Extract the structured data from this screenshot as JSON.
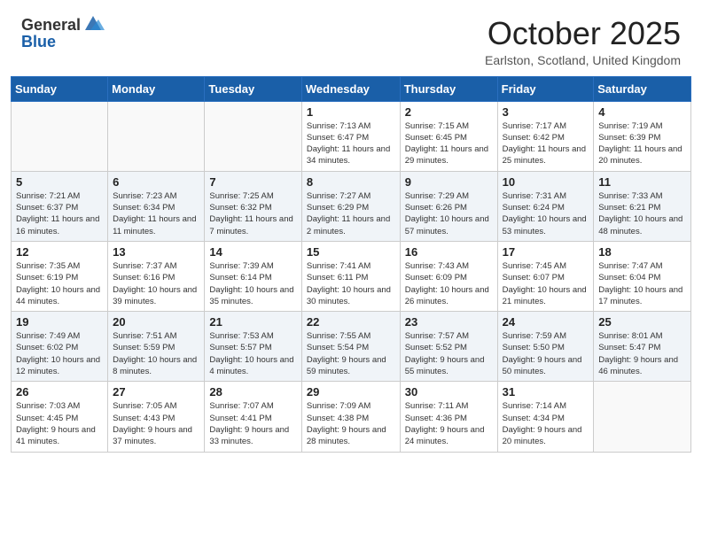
{
  "header": {
    "logo_general": "General",
    "logo_blue": "Blue",
    "month": "October 2025",
    "location": "Earlston, Scotland, United Kingdom"
  },
  "weekdays": [
    "Sunday",
    "Monday",
    "Tuesday",
    "Wednesday",
    "Thursday",
    "Friday",
    "Saturday"
  ],
  "weeks": [
    [
      {
        "day": "",
        "sunrise": "",
        "sunset": "",
        "daylight": ""
      },
      {
        "day": "",
        "sunrise": "",
        "sunset": "",
        "daylight": ""
      },
      {
        "day": "",
        "sunrise": "",
        "sunset": "",
        "daylight": ""
      },
      {
        "day": "1",
        "sunrise": "Sunrise: 7:13 AM",
        "sunset": "Sunset: 6:47 PM",
        "daylight": "Daylight: 11 hours and 34 minutes."
      },
      {
        "day": "2",
        "sunrise": "Sunrise: 7:15 AM",
        "sunset": "Sunset: 6:45 PM",
        "daylight": "Daylight: 11 hours and 29 minutes."
      },
      {
        "day": "3",
        "sunrise": "Sunrise: 7:17 AM",
        "sunset": "Sunset: 6:42 PM",
        "daylight": "Daylight: 11 hours and 25 minutes."
      },
      {
        "day": "4",
        "sunrise": "Sunrise: 7:19 AM",
        "sunset": "Sunset: 6:39 PM",
        "daylight": "Daylight: 11 hours and 20 minutes."
      }
    ],
    [
      {
        "day": "5",
        "sunrise": "Sunrise: 7:21 AM",
        "sunset": "Sunset: 6:37 PM",
        "daylight": "Daylight: 11 hours and 16 minutes."
      },
      {
        "day": "6",
        "sunrise": "Sunrise: 7:23 AM",
        "sunset": "Sunset: 6:34 PM",
        "daylight": "Daylight: 11 hours and 11 minutes."
      },
      {
        "day": "7",
        "sunrise": "Sunrise: 7:25 AM",
        "sunset": "Sunset: 6:32 PM",
        "daylight": "Daylight: 11 hours and 7 minutes."
      },
      {
        "day": "8",
        "sunrise": "Sunrise: 7:27 AM",
        "sunset": "Sunset: 6:29 PM",
        "daylight": "Daylight: 11 hours and 2 minutes."
      },
      {
        "day": "9",
        "sunrise": "Sunrise: 7:29 AM",
        "sunset": "Sunset: 6:26 PM",
        "daylight": "Daylight: 10 hours and 57 minutes."
      },
      {
        "day": "10",
        "sunrise": "Sunrise: 7:31 AM",
        "sunset": "Sunset: 6:24 PM",
        "daylight": "Daylight: 10 hours and 53 minutes."
      },
      {
        "day": "11",
        "sunrise": "Sunrise: 7:33 AM",
        "sunset": "Sunset: 6:21 PM",
        "daylight": "Daylight: 10 hours and 48 minutes."
      }
    ],
    [
      {
        "day": "12",
        "sunrise": "Sunrise: 7:35 AM",
        "sunset": "Sunset: 6:19 PM",
        "daylight": "Daylight: 10 hours and 44 minutes."
      },
      {
        "day": "13",
        "sunrise": "Sunrise: 7:37 AM",
        "sunset": "Sunset: 6:16 PM",
        "daylight": "Daylight: 10 hours and 39 minutes."
      },
      {
        "day": "14",
        "sunrise": "Sunrise: 7:39 AM",
        "sunset": "Sunset: 6:14 PM",
        "daylight": "Daylight: 10 hours and 35 minutes."
      },
      {
        "day": "15",
        "sunrise": "Sunrise: 7:41 AM",
        "sunset": "Sunset: 6:11 PM",
        "daylight": "Daylight: 10 hours and 30 minutes."
      },
      {
        "day": "16",
        "sunrise": "Sunrise: 7:43 AM",
        "sunset": "Sunset: 6:09 PM",
        "daylight": "Daylight: 10 hours and 26 minutes."
      },
      {
        "day": "17",
        "sunrise": "Sunrise: 7:45 AM",
        "sunset": "Sunset: 6:07 PM",
        "daylight": "Daylight: 10 hours and 21 minutes."
      },
      {
        "day": "18",
        "sunrise": "Sunrise: 7:47 AM",
        "sunset": "Sunset: 6:04 PM",
        "daylight": "Daylight: 10 hours and 17 minutes."
      }
    ],
    [
      {
        "day": "19",
        "sunrise": "Sunrise: 7:49 AM",
        "sunset": "Sunset: 6:02 PM",
        "daylight": "Daylight: 10 hours and 12 minutes."
      },
      {
        "day": "20",
        "sunrise": "Sunrise: 7:51 AM",
        "sunset": "Sunset: 5:59 PM",
        "daylight": "Daylight: 10 hours and 8 minutes."
      },
      {
        "day": "21",
        "sunrise": "Sunrise: 7:53 AM",
        "sunset": "Sunset: 5:57 PM",
        "daylight": "Daylight: 10 hours and 4 minutes."
      },
      {
        "day": "22",
        "sunrise": "Sunrise: 7:55 AM",
        "sunset": "Sunset: 5:54 PM",
        "daylight": "Daylight: 9 hours and 59 minutes."
      },
      {
        "day": "23",
        "sunrise": "Sunrise: 7:57 AM",
        "sunset": "Sunset: 5:52 PM",
        "daylight": "Daylight: 9 hours and 55 minutes."
      },
      {
        "day": "24",
        "sunrise": "Sunrise: 7:59 AM",
        "sunset": "Sunset: 5:50 PM",
        "daylight": "Daylight: 9 hours and 50 minutes."
      },
      {
        "day": "25",
        "sunrise": "Sunrise: 8:01 AM",
        "sunset": "Sunset: 5:47 PM",
        "daylight": "Daylight: 9 hours and 46 minutes."
      }
    ],
    [
      {
        "day": "26",
        "sunrise": "Sunrise: 7:03 AM",
        "sunset": "Sunset: 4:45 PM",
        "daylight": "Daylight: 9 hours and 41 minutes."
      },
      {
        "day": "27",
        "sunrise": "Sunrise: 7:05 AM",
        "sunset": "Sunset: 4:43 PM",
        "daylight": "Daylight: 9 hours and 37 minutes."
      },
      {
        "day": "28",
        "sunrise": "Sunrise: 7:07 AM",
        "sunset": "Sunset: 4:41 PM",
        "daylight": "Daylight: 9 hours and 33 minutes."
      },
      {
        "day": "29",
        "sunrise": "Sunrise: 7:09 AM",
        "sunset": "Sunset: 4:38 PM",
        "daylight": "Daylight: 9 hours and 28 minutes."
      },
      {
        "day": "30",
        "sunrise": "Sunrise: 7:11 AM",
        "sunset": "Sunset: 4:36 PM",
        "daylight": "Daylight: 9 hours and 24 minutes."
      },
      {
        "day": "31",
        "sunrise": "Sunrise: 7:14 AM",
        "sunset": "Sunset: 4:34 PM",
        "daylight": "Daylight: 9 hours and 20 minutes."
      },
      {
        "day": "",
        "sunrise": "",
        "sunset": "",
        "daylight": ""
      }
    ]
  ]
}
